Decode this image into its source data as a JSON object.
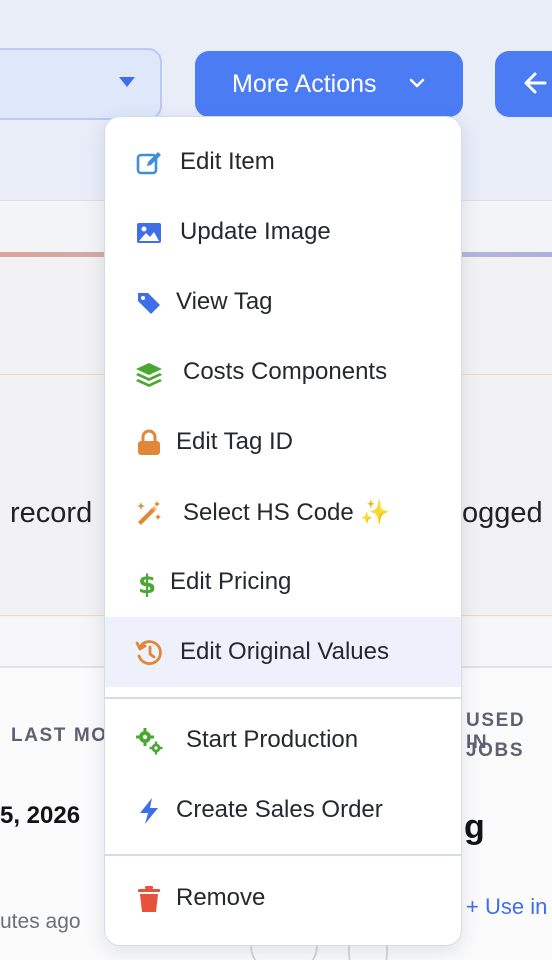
{
  "header": {
    "more_actions_label": "More Actions"
  },
  "background": {
    "left_text": "record",
    "right_text": "ogged",
    "last_modified_label": "LAST MO",
    "date_value": "5, 2026",
    "used_in_label_1": "USED IN",
    "used_in_label_2": "JOBS",
    "big_value": "g",
    "time_ago": "utes ago",
    "use_in_button": "+ Use in"
  },
  "menu": {
    "items": [
      {
        "label": "Edit Item",
        "icon": "edit-icon",
        "color": "#3d8fd9"
      },
      {
        "label": "Update Image",
        "icon": "image-icon",
        "color": "#3f6fe8"
      },
      {
        "label": "View Tag",
        "icon": "tag-icon",
        "color": "#3f6fe8"
      },
      {
        "label": "Costs Components",
        "icon": "layers-icon",
        "color": "#4aa832"
      },
      {
        "label": "Edit Tag ID",
        "icon": "lock-icon",
        "color": "#e0873a"
      },
      {
        "label": "Select HS Code ✨",
        "icon": "magic-wand-icon",
        "color": "#e0873a"
      },
      {
        "label": "Edit Pricing",
        "icon": "dollar-icon",
        "color": "#4aa832"
      },
      {
        "label": "Edit Original Values",
        "icon": "history-icon",
        "color": "#e0873a"
      },
      {
        "label": "Start Production",
        "icon": "gears-icon",
        "color": "#4aa832"
      },
      {
        "label": "Create Sales Order",
        "icon": "bolt-icon",
        "color": "#3f6fe8"
      },
      {
        "label": "Remove",
        "icon": "trash-icon",
        "color": "#e5533a"
      }
    ]
  },
  "colors": {
    "primary": "#4c7cf4",
    "active_row": "#eef1fb"
  }
}
